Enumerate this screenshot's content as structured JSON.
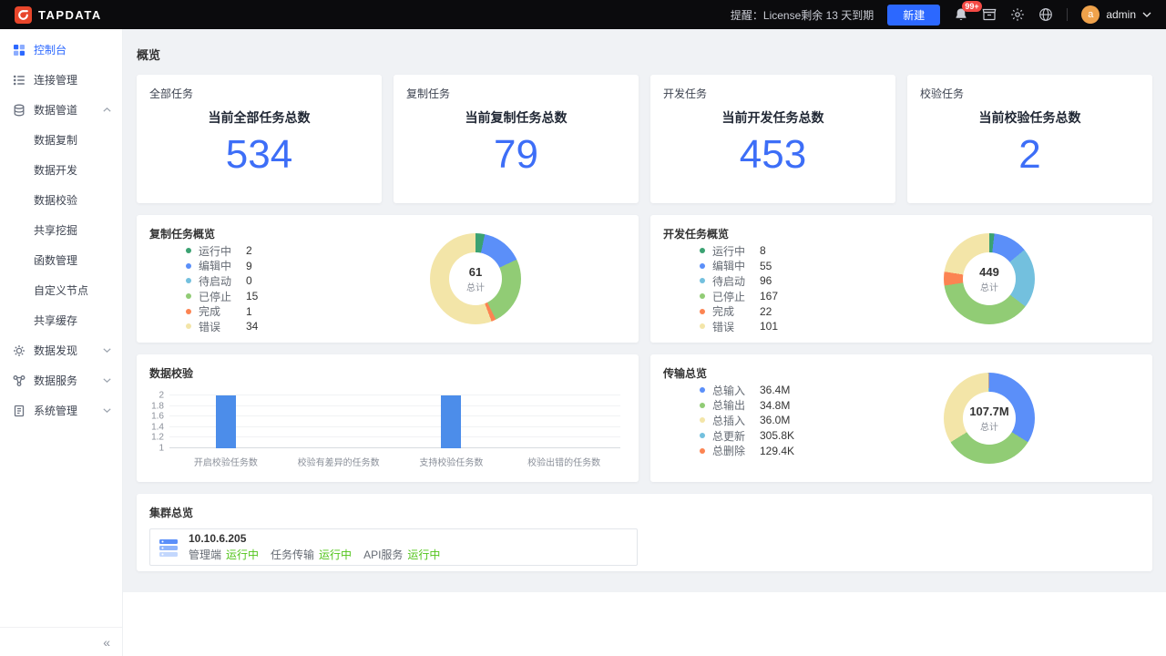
{
  "topbar": {
    "logo_text": "TAPDATA",
    "license_notice": "提醒：License剩余 13 天到期",
    "new_button_label": "新建",
    "notification_badge": "99+",
    "username": "admin",
    "avatar_letter": "a"
  },
  "sidebar": {
    "items": [
      {
        "label": "控制台"
      },
      {
        "label": "连接管理"
      },
      {
        "label": "数据管道"
      },
      {
        "label": "数据复制"
      },
      {
        "label": "数据开发"
      },
      {
        "label": "数据校验"
      },
      {
        "label": "共享挖掘"
      },
      {
        "label": "函数管理"
      },
      {
        "label": "自定义节点"
      },
      {
        "label": "共享缓存"
      },
      {
        "label": "数据发现"
      },
      {
        "label": "数据服务"
      },
      {
        "label": "系统管理"
      }
    ]
  },
  "page": {
    "title": "概览"
  },
  "stats": [
    {
      "category": "全部任务",
      "title": "当前全部任务总数",
      "value": "534"
    },
    {
      "category": "复制任务",
      "title": "当前复制任务总数",
      "value": "79"
    },
    {
      "category": "开发任务",
      "title": "当前开发任务总数",
      "value": "453"
    },
    {
      "category": "校验任务",
      "title": "当前校验任务总数",
      "value": "2"
    }
  ],
  "charts": {
    "replication": {
      "type": "pie",
      "title": "复制任务概览",
      "total": "61",
      "total_label": "总计",
      "labels": [
        "运行中",
        "编辑中",
        "待启动",
        "已停止",
        "完成",
        "错误"
      ],
      "values": [
        2,
        9,
        0,
        15,
        1,
        34
      ],
      "display_values": [
        "2",
        "9",
        "0",
        "15",
        "1",
        "34"
      ],
      "colors": [
        "#3BA272",
        "#5B8FF9",
        "#73C0DE",
        "#91CC75",
        "#FC8452",
        "#F3E5A8"
      ]
    },
    "development": {
      "type": "pie",
      "title": "开发任务概览",
      "total": "449",
      "total_label": "总计",
      "labels": [
        "运行中",
        "编辑中",
        "待启动",
        "已停止",
        "完成",
        "错误"
      ],
      "values": [
        8,
        55,
        96,
        167,
        22,
        101
      ],
      "display_values": [
        "8",
        "55",
        "96",
        "167",
        "22",
        "101"
      ],
      "colors": [
        "#3BA272",
        "#5B8FF9",
        "#73C0DE",
        "#91CC75",
        "#FC8452",
        "#F3E5A8"
      ]
    },
    "validation": {
      "type": "bar",
      "title": "数据校验",
      "categories": [
        "开启校验任务数",
        "校验有差异的任务数",
        "支持校验任务数",
        "校验出错的任务数"
      ],
      "values": [
        2,
        0,
        2,
        0
      ],
      "ylim": [
        1,
        2
      ],
      "yticks": [
        2,
        1.8,
        1.6,
        1.4,
        1.2,
        1
      ],
      "bar_color": "#4C8DEA"
    },
    "transfer": {
      "type": "pie",
      "title": "传输总览",
      "total": "107.7M",
      "total_label": "总计",
      "labels": [
        "总输入",
        "总输出",
        "总插入",
        "总更新",
        "总删除"
      ],
      "values": [
        36400000,
        34800000,
        36000000,
        305800,
        129400
      ],
      "display_values": [
        "36.4M",
        "34.8M",
        "36.0M",
        "305.8K",
        "129.4K"
      ],
      "colors": [
        "#5B8FF9",
        "#91CC75",
        "#F3E5A8",
        "#73C0DE",
        "#FC8452"
      ]
    }
  },
  "cluster": {
    "title": "集群总览",
    "node_ip": "10.10.6.205",
    "services": [
      {
        "name": "管理端",
        "status": "运行中"
      },
      {
        "name": "任务传输",
        "status": "运行中"
      },
      {
        "name": "API服务",
        "status": "运行中"
      }
    ]
  },
  "colors": {
    "primary_blue": "#2C68FF",
    "stat_number_blue": "#3D6EF7",
    "status_green": "#52C41A",
    "topbar_bg": "#0B0B0D",
    "brand_red": "#E8462B"
  }
}
